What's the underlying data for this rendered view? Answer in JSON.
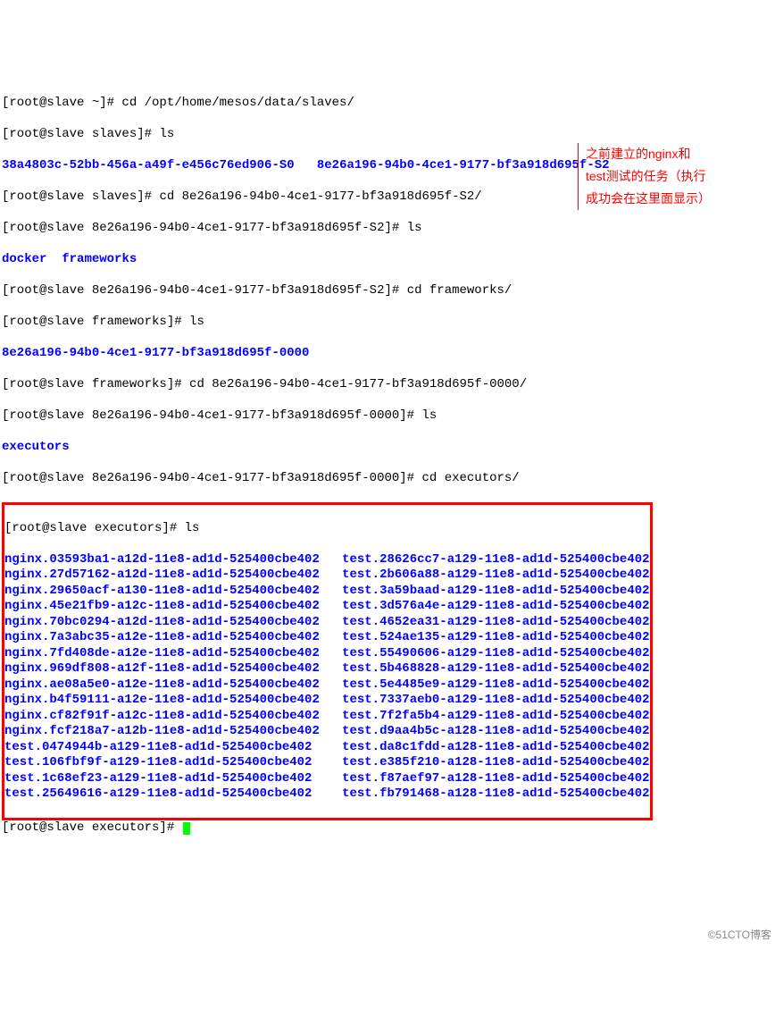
{
  "lines": {
    "l1_prompt": "[root@slave ~]# ",
    "l1_cmd": "cd /opt/home/mesos/data/slaves/",
    "l2_prompt": "[root@slave slaves]# ",
    "l2_cmd": "ls",
    "l3_col1": "38a4803c-52bb-456a-a49f-e456c76ed906-S0",
    "l3_col2": "8e26a196-94b0-4ce1-9177-bf3a918d695f-S2",
    "l4_prompt": "[root@slave slaves]# ",
    "l4_cmd": "cd 8e26a196-94b0-4ce1-9177-bf3a918d695f-S2/",
    "l5_prompt": "[root@slave 8e26a196-94b0-4ce1-9177-bf3a918d695f-S2]# ",
    "l5_cmd": "ls",
    "l6_a": "docker",
    "l6_b": "frameworks",
    "l7_prompt": "[root@slave 8e26a196-94b0-4ce1-9177-bf3a918d695f-S2]# ",
    "l7_cmd": "cd frameworks/",
    "l8_prompt": "[root@slave frameworks]# ",
    "l8_cmd": "ls",
    "l9": "8e26a196-94b0-4ce1-9177-bf3a918d695f-0000",
    "l10_prompt": "[root@slave frameworks]# ",
    "l10_cmd": "cd 8e26a196-94b0-4ce1-9177-bf3a918d695f-0000/",
    "l11_prompt": "[root@slave 8e26a196-94b0-4ce1-9177-bf3a918d695f-0000]# ",
    "l11_cmd": "ls",
    "l12": "executors",
    "l13_prompt": "[root@slave 8e26a196-94b0-4ce1-9177-bf3a918d695f-0000]# ",
    "l13_cmd": "cd executors/",
    "l14_prompt": "[root@slave executors]# ",
    "l14_cmd": "ls",
    "l_end_prompt": "[root@slave executors]# "
  },
  "ls_grid": [
    [
      "nginx.03593ba1-a12d-11e8-ad1d-525400cbe402",
      "test.28626cc7-a129-11e8-ad1d-525400cbe402"
    ],
    [
      "nginx.27d57162-a12d-11e8-ad1d-525400cbe402",
      "test.2b606a88-a129-11e8-ad1d-525400cbe402"
    ],
    [
      "nginx.29650acf-a130-11e8-ad1d-525400cbe402",
      "test.3a59baad-a129-11e8-ad1d-525400cbe402"
    ],
    [
      "nginx.45e21fb9-a12c-11e8-ad1d-525400cbe402",
      "test.3d576a4e-a129-11e8-ad1d-525400cbe402"
    ],
    [
      "nginx.70bc0294-a12d-11e8-ad1d-525400cbe402",
      "test.4652ea31-a129-11e8-ad1d-525400cbe402"
    ],
    [
      "nginx.7a3abc35-a12e-11e8-ad1d-525400cbe402",
      "test.524ae135-a129-11e8-ad1d-525400cbe402"
    ],
    [
      "nginx.7fd408de-a12e-11e8-ad1d-525400cbe402",
      "test.55490606-a129-11e8-ad1d-525400cbe402"
    ],
    [
      "nginx.969df808-a12f-11e8-ad1d-525400cbe402",
      "test.5b468828-a129-11e8-ad1d-525400cbe402"
    ],
    [
      "nginx.ae08a5e0-a12e-11e8-ad1d-525400cbe402",
      "test.5e4485e9-a129-11e8-ad1d-525400cbe402"
    ],
    [
      "nginx.b4f59111-a12e-11e8-ad1d-525400cbe402",
      "test.7337aeb0-a129-11e8-ad1d-525400cbe402"
    ],
    [
      "nginx.cf82f91f-a12c-11e8-ad1d-525400cbe402",
      "test.7f2fa5b4-a129-11e8-ad1d-525400cbe402"
    ],
    [
      "nginx.fcf218a7-a12b-11e8-ad1d-525400cbe402",
      "test.d9aa4b5c-a128-11e8-ad1d-525400cbe402"
    ],
    [
      "test.0474944b-a129-11e8-ad1d-525400cbe402",
      "test.da8c1fdd-a128-11e8-ad1d-525400cbe402"
    ],
    [
      "test.106fbf9f-a129-11e8-ad1d-525400cbe402",
      "test.e385f210-a128-11e8-ad1d-525400cbe402"
    ],
    [
      "test.1c68ef23-a129-11e8-ad1d-525400cbe402",
      "test.f87aef97-a128-11e8-ad1d-525400cbe402"
    ],
    [
      "test.25649616-a129-11e8-ad1d-525400cbe402",
      "test.fb791468-a128-11e8-ad1d-525400cbe402"
    ]
  ],
  "annotation": {
    "line1": "之前建立的nginx和",
    "line2": "test测试的任务（执行",
    "line3": "成功会在这里面显示）"
  },
  "watermark": "©51CTO博客"
}
